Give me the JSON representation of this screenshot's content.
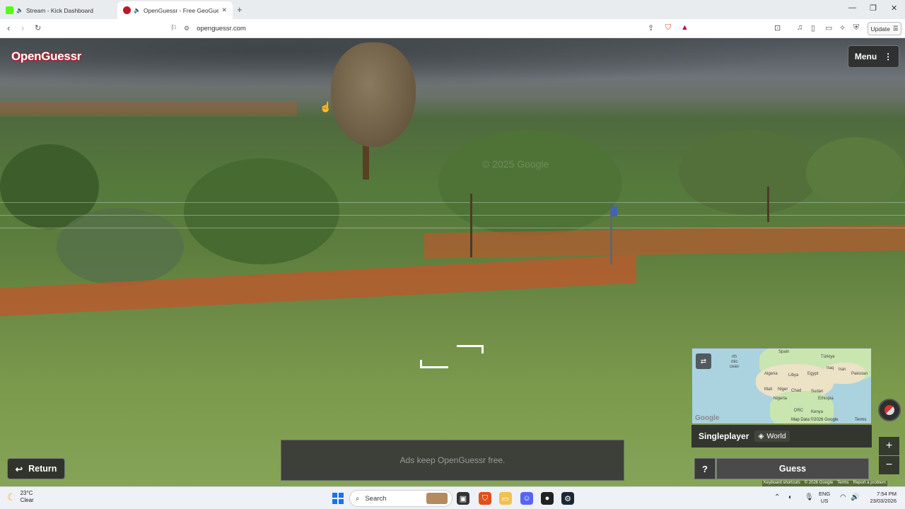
{
  "browser": {
    "tabs": [
      {
        "title": "Stream - Kick Dashboard",
        "favicon_color": "#53fc18"
      },
      {
        "title": "OpenGuessr - Free GeoGuessr",
        "favicon_color": "#c2142b"
      }
    ],
    "new_tab_glyph": "+",
    "url": "openguessr.com",
    "update_label": "Update"
  },
  "game": {
    "logo": "OpenGuessr",
    "menu_label": "Menu",
    "watermark": "© 2025 Google",
    "minimap": {
      "labels": [
        "Spain",
        "Türkiye",
        "rth",
        "ntic",
        "cean",
        "Algeria",
        "Libya",
        "Egypt",
        "Iraq",
        "Iran",
        "Pakistan",
        "Mali",
        "Niger",
        "Chad",
        "Sudan",
        "Ethiopia",
        "Nigeria",
        "DRC",
        "Kenya"
      ],
      "attribution": "Map Data ©2026 Google",
      "terms": "Terms",
      "google": "Google"
    },
    "mode_label": "Singleplayer",
    "scope_label": "World",
    "help_label": "?",
    "guess_label": "Guess",
    "return_label": "Return",
    "ad_text": "Ads keep OpenGuessr free.",
    "zoom_in": "+",
    "zoom_out": "−",
    "footer": [
      "Keyboard shortcuts",
      "© 2026 Google",
      "Terms",
      "Report a problem"
    ]
  },
  "taskbar": {
    "weather_temp": "23°C",
    "weather_desc": "Clear",
    "search_placeholder": "Search",
    "lang_top": "ENG",
    "lang_bottom": "US",
    "time": "7:54 PM",
    "date": "23/03/2026"
  }
}
